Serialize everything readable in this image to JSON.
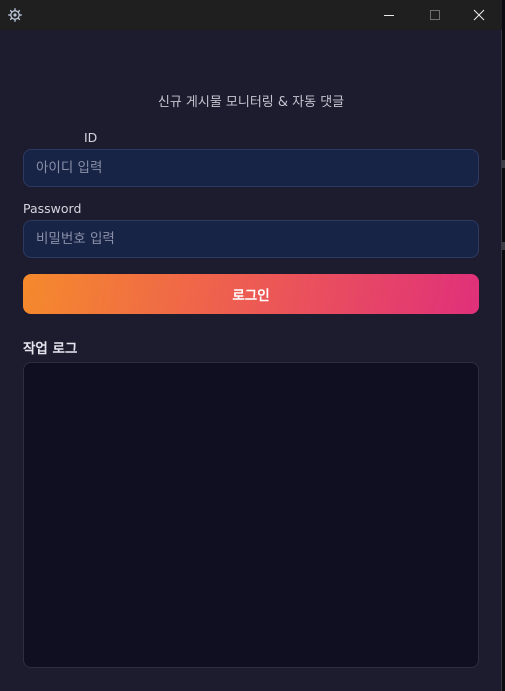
{
  "titlebar": {
    "app_icon": "gear-icon",
    "minimize_icon": "minimize-icon",
    "maximize_icon": "maximize-icon",
    "close_icon": "close-icon"
  },
  "main": {
    "subtitle": "신규 게시물 모니터링 & 자동 댓글",
    "id_label": "ID",
    "id_placeholder": "아이디 입력",
    "id_value": "",
    "password_label": "Password",
    "password_placeholder": "비밀번호 입력",
    "password_value": "",
    "login_label": "로그인",
    "log_title": "작업 로그",
    "log_content": ""
  },
  "colors": {
    "background": "#1d1b2e",
    "input_bg": "#172446",
    "log_bg": "#100f21",
    "gradient_start": "#f58a2c",
    "gradient_end": "#e0307a"
  }
}
